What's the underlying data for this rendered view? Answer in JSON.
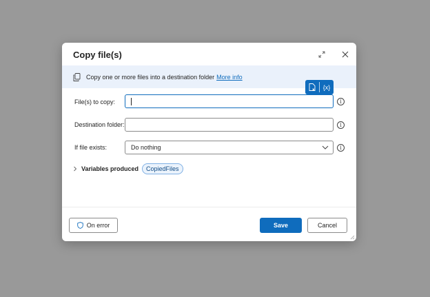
{
  "dialog": {
    "title": "Copy file(s)",
    "banner_text": "Copy one or more files into a destination folder",
    "banner_link": "More info"
  },
  "picker": {
    "file_icon": "file-select-icon",
    "variable_label": "{x}"
  },
  "fields": {
    "files_to_copy": {
      "label": "File(s) to copy:",
      "value": ""
    },
    "destination_folder": {
      "label": "Destination folder:",
      "value": ""
    },
    "if_file_exists": {
      "label": "If file exists:",
      "value": "Do nothing"
    }
  },
  "info_glyph": "i",
  "variables": {
    "label": "Variables produced",
    "items": [
      "CopiedFiles"
    ]
  },
  "footer": {
    "on_error": "On error",
    "save": "Save",
    "cancel": "Cancel"
  },
  "colors": {
    "accent": "#0f6cbd",
    "banner_bg": "#eaf1fb",
    "backdrop": "#999999"
  }
}
